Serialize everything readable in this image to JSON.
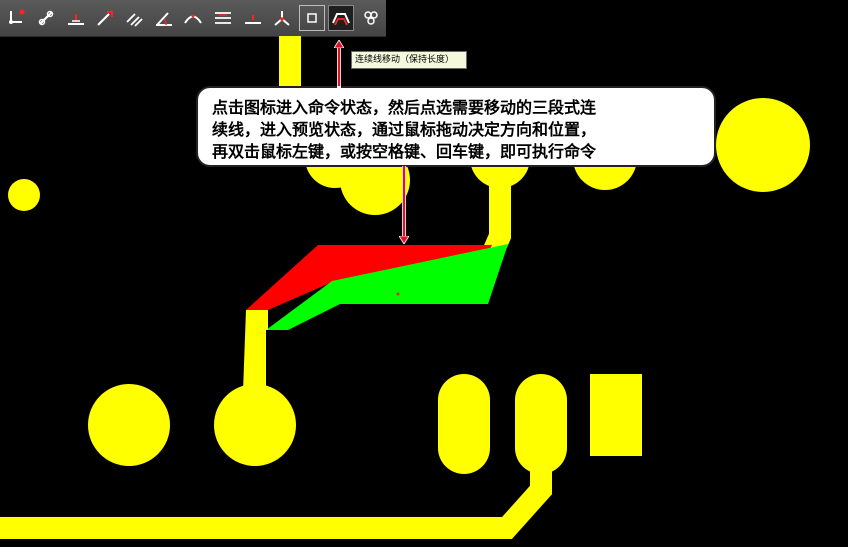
{
  "toolbar": {
    "icons": [
      "route-icon",
      "vias-icon",
      "add-corner-icon",
      "stretch-trace-icon",
      "parallel-traces-icon",
      "angle-trace-icon",
      "arc-corner-icon",
      "multi-trace-icon",
      "split-trace-icon",
      "branch-icon",
      "pad-select-icon",
      "move-three-segment-icon",
      "unroute-icon"
    ],
    "active_index": 11
  },
  "tooltip": {
    "text": "连续线移动（保持长度）"
  },
  "callout": {
    "line1": "点击图标进入命令状态，然后点选需要移动的三段式连",
    "line2": "续线，进入预览状态，通过鼠标拖动决定方向和位置，",
    "line3": "再双击鼠标左键，或按空格键、回车键，即可执行命令"
  },
  "colors": {
    "copper": "#ffff00",
    "preview_old": "#ff0000",
    "preview_new": "#00ff00",
    "background": "#000000",
    "arrow": "#e0122a"
  }
}
